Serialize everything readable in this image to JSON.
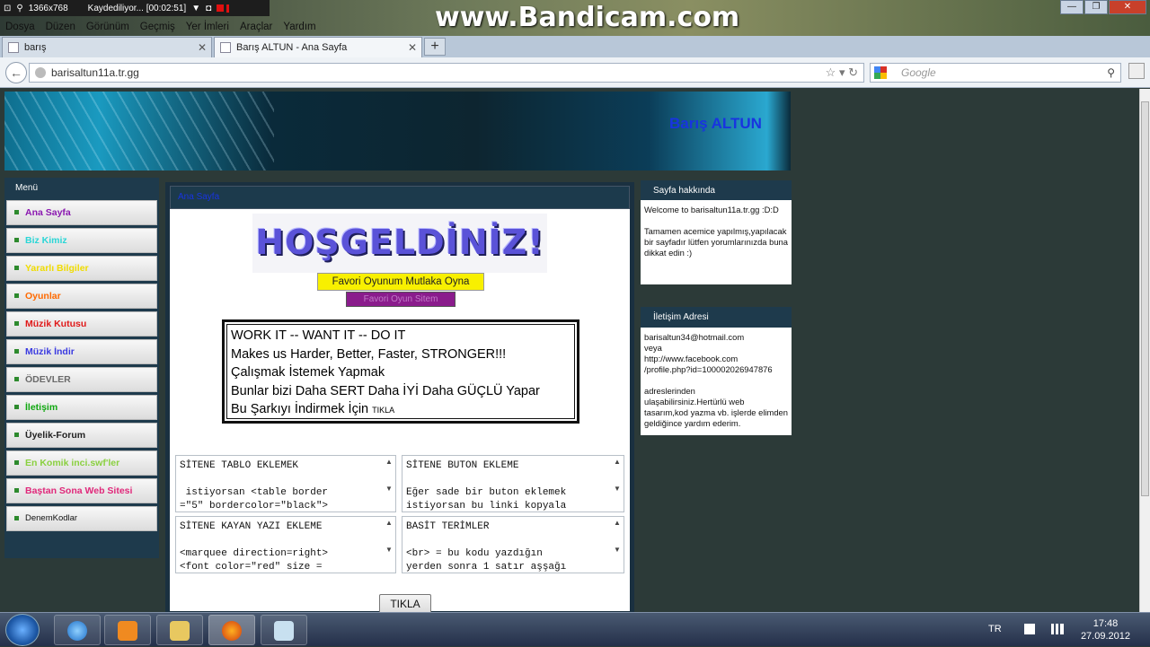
{
  "recorder": {
    "resolution": "1366x768",
    "status": "Kaydediliyor... [00:02:51]"
  },
  "watermark": "www.Bandicam.com",
  "menubar": [
    "Dosya",
    "Düzen",
    "Görünüm",
    "Geçmiş",
    "Yer İmleri",
    "Araçlar",
    "Yardım"
  ],
  "tabs": [
    {
      "label": "barış",
      "active": false
    },
    {
      "label": "Barış ALTUN - Ana Sayfa",
      "active": true
    }
  ],
  "newtab_label": "+",
  "address": {
    "url": "barisaltun11a.tr.gg"
  },
  "search": {
    "placeholder": "Google"
  },
  "site": {
    "title": "Barış ALTUN",
    "menu_header": "Menü",
    "menu_items": [
      {
        "label": "Ana Sayfa",
        "color": "#8a18b0"
      },
      {
        "label": "Biz Kimiz",
        "color": "#2ad6d6"
      },
      {
        "label": "Yararlı Bilgiler",
        "color": "#f0dc00"
      },
      {
        "label": "Oyunlar",
        "color": "#ff6a00"
      },
      {
        "label": "Müzik Kutusu",
        "color": "#e01818"
      },
      {
        "label": "Müzik İndir",
        "color": "#3a3ae0"
      },
      {
        "label": "ÖDEVLER",
        "color": "#6a6a6a"
      },
      {
        "label": "İletişim",
        "color": "#10a810"
      },
      {
        "label": "Üyelik-Forum",
        "color": "#222222"
      },
      {
        "label": "En Komik inci.swf'ler",
        "color": "#8ad040"
      },
      {
        "label": "Baştan Sona Web Sitesi",
        "color": "#e0287a"
      },
      {
        "label": "DenemKodlar",
        "color": "#111111"
      }
    ],
    "content_tab": "Ana Sayfa",
    "welcome": "HOŞGELDİNİZ!",
    "buttons": {
      "favori": "Favori Oyunum Mutlaka Oyna",
      "site": "Favori Oyun Sitem"
    },
    "motto_lines": [
      "WORK IT -- WANT IT -- DO IT",
      "Makes us Harder, Better, Faster, STRONGER!!!",
      "Çalışmak İstemek Yapmak",
      "Bunlar bizi Daha SERT Daha İYİ Daha GÜÇLÜ Yapar"
    ],
    "motto_last": "Bu Şarkıyı İndirmek İçin",
    "motto_link": "TIKLA",
    "code_boxes": [
      {
        "text": "SİTENE TABLO EKLEMEK\n\n istiyorsan <table border\n=\"5\" bordercolor=\"black\">"
      },
      {
        "text": "SİTENE BUTON EKLEME\n\nEğer sade bir buton eklemek\nistiyorsan bu linki kopyala"
      },
      {
        "text": "SİTENE KAYAN YAZI EKLEME\n\n<marquee direction=right>\n<font color=\"red\" size ="
      },
      {
        "text": "BASİT TERİMLER\n\n<br> = bu kodu yazdığın\nyerden sonra 1 satır aşşağı"
      }
    ],
    "tikla_button": "TIKLA",
    "about": {
      "header": "Sayfa hakkında",
      "text": "Welcome to barisaltun11a.tr.gg :D:D\n\nTamamen acemice yapılmış,yapılacak bir sayfadır lütfen yorumlarınızda buna dikkat edin :)"
    },
    "contact": {
      "header": "İletişim Adresi",
      "text": "barisaltun34@hotmail.com\nveya\nhttp://www.facebook.com\n/profile.php?id=100002026947876\n\nadreslerinden\nulaşabilirsiniz.Hertürlü web tasarım,kod yazma vb. işlerde elimden geldiğince yardım ederim."
    }
  },
  "tray": {
    "lang": "TR",
    "time": "17:48",
    "date": "27.09.2012"
  }
}
